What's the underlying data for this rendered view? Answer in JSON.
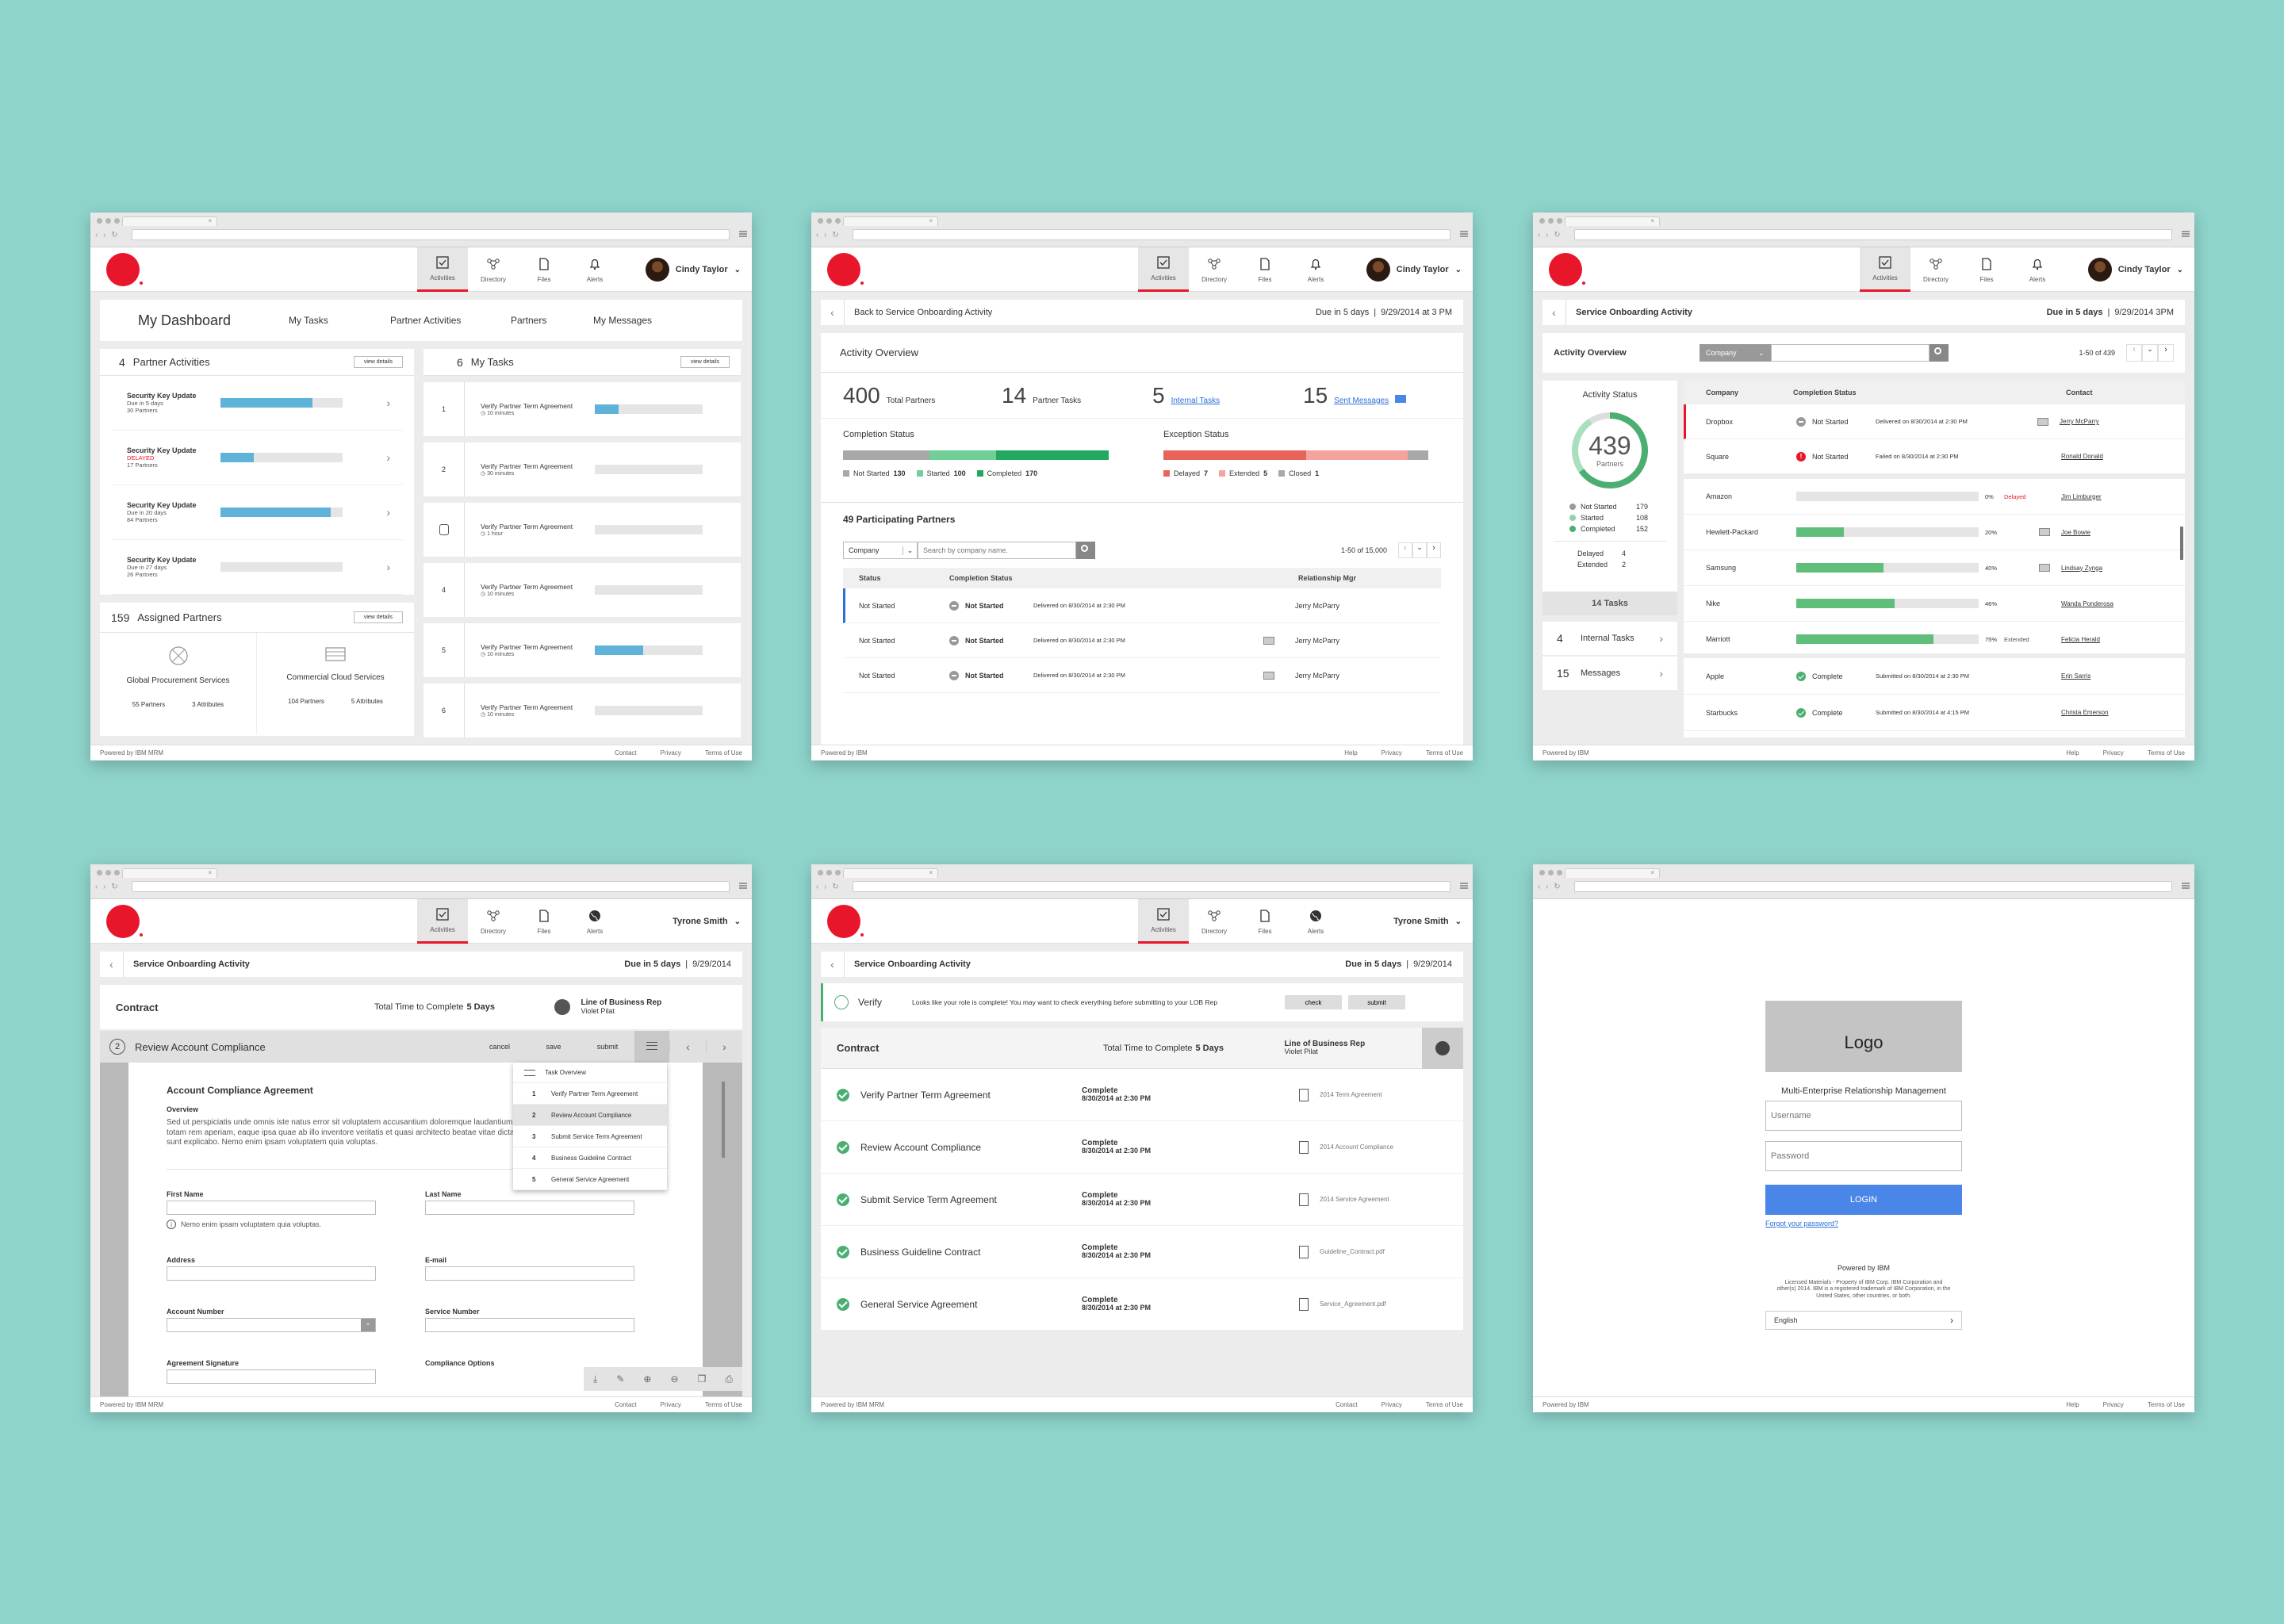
{
  "nav": {
    "activities": "Activities",
    "directory": "Directory",
    "files": "Files",
    "alerts": "Alerts"
  },
  "users": {
    "cindy": "Cindy Taylor",
    "tyrone": "Tyrone Smith"
  },
  "w1": {
    "tabs": [
      "My Dashboard",
      "My Tasks",
      "Partner Activities",
      "Partners",
      "My Messages"
    ],
    "pa_count": "4",
    "pa_title": "Partner Activities",
    "view_details": "view details",
    "activities": [
      {
        "title": "Security Key Update",
        "due": "Due in 5 days",
        "status": "",
        "partners": "30 Partners",
        "progress": 0.75
      },
      {
        "title": "Security Key Update",
        "due": "",
        "status": "DELAYED",
        "partners": "17 Partners",
        "progress": 0.27
      },
      {
        "title": "Security Key Update",
        "due": "Due in 20 days",
        "status": "",
        "partners": "84 Partners",
        "progress": 0.9
      },
      {
        "title": "Security Key Update",
        "due": "Due in 27 days",
        "status": "",
        "partners": "26 Partners",
        "progress": 0
      }
    ],
    "ap_count": "159",
    "ap_title": "Assigned Partners",
    "partners": [
      {
        "name": "Global Procurement Services",
        "partners": "55 Partners",
        "attributes": "3 Attributes"
      },
      {
        "name": "Commercial Cloud Services",
        "partners": "104 Partners",
        "attributes": "5 Attributes"
      }
    ],
    "mt_count": "6",
    "mt_title": "My Tasks",
    "tasks": [
      {
        "num": "1",
        "title": "Verify Partner Term Agreement",
        "time": "10 minutes",
        "progress": 0.22
      },
      {
        "num": "2",
        "title": "Verify Partner Term Agreement",
        "time": "30 minutes",
        "progress": 0
      },
      {
        "num": "",
        "title": "Verify Partner Term Agreement",
        "time": "1 hour",
        "progress": 0
      },
      {
        "num": "4",
        "title": "Verify Partner Term Agreement",
        "time": "10 minutes",
        "progress": 0
      },
      {
        "num": "5",
        "title": "Verify Partner Term Agreement",
        "time": "10 minutes",
        "progress": 0.45
      },
      {
        "num": "6",
        "title": "Verify Partner Term Agreement",
        "time": "10 minutes",
        "progress": 0
      }
    ],
    "footer": {
      "powered": "Powered by IBM MRM",
      "links": [
        "Contact",
        "Privacy",
        "Terms of Use"
      ]
    }
  },
  "w2": {
    "back": "Back to Service Onboarding Activity",
    "due": "Due in 5 days",
    "date": "9/29/2014 at 3 PM",
    "overview": "Activity Overview",
    "stats": [
      {
        "num": "400",
        "label": "Total Partners",
        "link": false
      },
      {
        "num": "14",
        "label": "Partner Tasks",
        "link": false
      },
      {
        "num": "5",
        "label": "Internal Tasks",
        "link": true
      },
      {
        "num": "15",
        "label": "Sent Messages",
        "link": true
      }
    ],
    "completion": {
      "title": "Completion Status",
      "items": [
        {
          "label": "Not Started",
          "value": "130",
          "color": "#a8a8a8"
        },
        {
          "label": "Started",
          "value": "100",
          "color": "#6fcf97"
        },
        {
          "label": "Completed",
          "value": "170",
          "color": "#21a861"
        }
      ]
    },
    "exception": {
      "title": "Exception Status",
      "items": [
        {
          "label": "Delayed",
          "value": "7",
          "color": "#e8645a"
        },
        {
          "label": "Extended",
          "value": "5",
          "color": "#f4a49c"
        },
        {
          "label": "Closed",
          "value": "1",
          "color": "#a8a8a8"
        }
      ]
    },
    "participating": "49 Participating Partners",
    "filter": "Company",
    "search_ph": "Search by company name.",
    "paging": "1-50 of 15,000",
    "cols": [
      "Status",
      "Completion Status",
      "Relationship Mgr"
    ],
    "rows": [
      {
        "status": "Not Started",
        "cstatus": "Not Started",
        "delivered": "Delivered on 8/30/2014 at 2:30 PM",
        "mgr": "Jerry McParry"
      },
      {
        "status": "Not Started",
        "cstatus": "Not Started",
        "delivered": "Delivered on 8/30/2014 at 2:30 PM",
        "mgr": "Jerry McParry"
      },
      {
        "status": "Not Started",
        "cstatus": "Not Started",
        "delivered": "Delivered on 8/30/2014 at 2:30 PM",
        "mgr": "Jerry McParry"
      }
    ],
    "footer": {
      "powered": "Powered by IBM",
      "links": [
        "Help",
        "Privacy",
        "Terms of Use"
      ]
    }
  },
  "w3": {
    "title": "Service Onboarding Activity",
    "due": "Due in 5 days",
    "date": "9/29/2014 3PM",
    "overview": "Activity Overview",
    "filter": "Company",
    "paging": "1-50 of 439",
    "status_title": "Activity Status",
    "total": "439",
    "total_label": "Partners",
    "legend": [
      {
        "label": "Not Started",
        "value": "179",
        "color": "#999"
      },
      {
        "label": "Started",
        "value": "108",
        "color": "#8fd4a8"
      },
      {
        "label": "Completed",
        "value": "152",
        "color": "#4caf72"
      }
    ],
    "delayed": "Delayed",
    "delayed_val": "4",
    "extended": "Extended",
    "extended_val": "2",
    "tasks": "14 Tasks",
    "internal_num": "4",
    "internal": "Internal Tasks",
    "msg_num": "15",
    "messages": "Messages",
    "cols": [
      "Company",
      "Completion Status",
      "Contact"
    ],
    "rows1": [
      {
        "company": "Dropbox",
        "status": "Not Started",
        "detail": "Delivered on 8/30/2014 at 2:30 PM",
        "contact": "Jerry McParry",
        "icon": "grey"
      },
      {
        "company": "Square",
        "status": "Not Started",
        "detail": "Failed on 8/30/2014 at 2:30 PM",
        "contact": "Ronald Donald",
        "icon": "red"
      }
    ],
    "rows2": [
      {
        "company": "Amazon",
        "pct": "0%",
        "pctv": 0,
        "extra": "Delayed",
        "contact": "Jim Limburger"
      },
      {
        "company": "Hewlett-Packard",
        "pct": "20%",
        "pctv": 0.26,
        "extra": "",
        "contact": "Joe Bowie"
      },
      {
        "company": "Samsung",
        "pct": "40%",
        "pctv": 0.48,
        "extra": "",
        "contact": "Lindsay Zynga"
      },
      {
        "company": "Nike",
        "pct": "46%",
        "pctv": 0.54,
        "extra": "",
        "contact": "Wanda Ponderosa"
      },
      {
        "company": "Marriott",
        "pct": "75%",
        "pctv": 0.75,
        "extra": "Extended",
        "contact": "Felicia Herald"
      }
    ],
    "rows3": [
      {
        "company": "Apple",
        "status": "Complete",
        "detail": "Submitted on 8/30/2014 at 2:30 PM",
        "contact": "Erin Sarris"
      },
      {
        "company": "Starbucks",
        "status": "Complete",
        "detail": "Submitted on 8/30/2014 at 4:15 PM",
        "contact": "Christa Emerson"
      }
    ],
    "footer": {
      "powered": "Powered by IBM",
      "links": [
        "Help",
        "Privacy",
        "Terms of Use"
      ]
    }
  },
  "w4": {
    "title": "Service Onboarding Activity",
    "due": "Due in 5 days",
    "date": "9/29/2014",
    "contract": "Contract",
    "total_time": "Total Time to Complete",
    "total_days": "5 Days",
    "lob": "Line of Business Rep",
    "lob_name": "Violet Pilat",
    "step": "2",
    "step_title": "Review Account Compliance",
    "actions": [
      "cancel",
      "save",
      "submit"
    ],
    "doc_title": "Account Compliance Agreement",
    "overview": "Overview",
    "body": "Sed ut perspiciatis unde omnis iste natus error sit voluptatem accusantium doloremque laudantium, totam rem aperiam, eaque ipsa quae ab illo inventore veritatis et quasi architecto beatae vitae dicta sunt explicabo. Nemo enim ipsam voluptatem quia voluptas.",
    "first": "First Name",
    "last": "Last Name",
    "hint": "Nemo enim ipsam voluptatem quia voluptas.",
    "address": "Address",
    "email": "E-mail",
    "account": "Account Number",
    "service": "Service Number",
    "sig": "Agreement Signature",
    "options": "Compliance Options",
    "menu": {
      "overview": "Task Overview",
      "items": [
        {
          "num": "1",
          "label": "Verify Partner Term Agreement"
        },
        {
          "num": "2",
          "label": "Review Account Compliance"
        },
        {
          "num": "3",
          "label": "Submit Service Term Agreement"
        },
        {
          "num": "4",
          "label": "Business Guideline Contract"
        },
        {
          "num": "5",
          "label": "General Service Agreement"
        }
      ]
    },
    "footer": {
      "powered": "Powered by IBM MRM",
      "links": [
        "Contact",
        "Privacy",
        "Terms of Use"
      ]
    }
  },
  "w5": {
    "title": "Service Onboarding Activity",
    "due": "Due in 5 days",
    "date": "9/29/2014",
    "verify": "Verify",
    "verify_msg": "Looks like your role is complete! You may want to check everything before submitting to your LOB Rep",
    "check": "check",
    "submit": "submit",
    "contract": "Contract",
    "total_time": "Total Time to Complete",
    "total_days": "5 Days",
    "lob": "Line of Business Rep",
    "lob_name": "Violet Pilat",
    "items": [
      {
        "title": "Verify Partner Term Agreement",
        "status": "Complete",
        "date": "8/30/2014 at 2:30 PM",
        "file": "2014 Term Agreement"
      },
      {
        "title": "Review Account Compliance",
        "status": "Complete",
        "date": "8/30/2014 at 2:30 PM",
        "file": "2014 Account Compliance"
      },
      {
        "title": "Submit Service Term Agreement",
        "status": "Complete",
        "date": "8/30/2014 at 2:30 PM",
        "file": "2014 Service Agreement"
      },
      {
        "title": "Business Guideline Contract",
        "status": "Complete",
        "date": "8/30/2014 at 2:30 PM",
        "file": "Guideline_Contract.pdf"
      },
      {
        "title": "General Service Agreement",
        "status": "Complete",
        "date": "8/30/2014 at 2:30 PM",
        "file": "Service_Agreement.pdf"
      }
    ],
    "footer": {
      "powered": "Powered by IBM MRM",
      "links": [
        "Contact",
        "Privacy",
        "Terms of Use"
      ]
    }
  },
  "w6": {
    "logo": "Logo",
    "app": "Multi-Enterprise Relationship Management",
    "username_ph": "Username",
    "password_ph": "Password",
    "login": "LOGIN",
    "forgot": "Forgot your password?",
    "powered": "Powered by IBM",
    "legal": "Licensed Materials - Property of IBM Corp. IBM Corporation and other(s) 2014. IBM is a registered trademark of IBM Corporation, in the United States, other countries, or both.",
    "lang": "English",
    "footer": {
      "powered": "Powered by IBM",
      "links": [
        "Help",
        "Privacy",
        "Terms of Use"
      ]
    }
  },
  "colors": {
    "brand": "#e8162b",
    "link": "#2b6fd9",
    "progress": "#5fb3d8",
    "success": "#4caf72",
    "login": "#4a86e8",
    "background": "#8ed4cb"
  }
}
